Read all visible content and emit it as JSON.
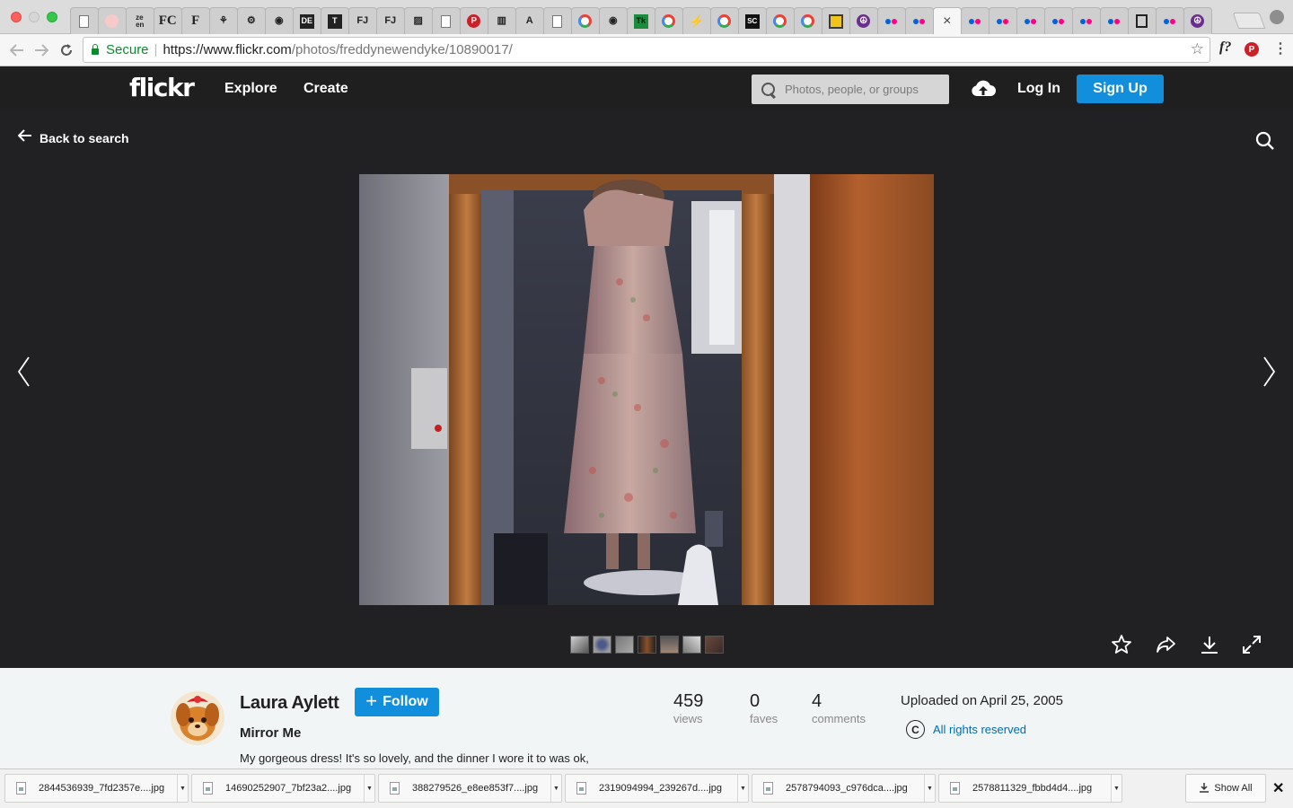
{
  "browser": {
    "tabs": [
      {
        "icon": "page-icon",
        "glyph": ""
      },
      {
        "icon": "pink-circle-icon",
        "glyph": ""
      },
      {
        "icon": "zhen-icon",
        "glyph": "ze\nen"
      },
      {
        "icon": "fc-icon",
        "glyph": "FC"
      },
      {
        "icon": "f-serif-icon",
        "glyph": "F"
      },
      {
        "icon": "figure-icon",
        "glyph": "⚘"
      },
      {
        "icon": "gear-icon",
        "glyph": "⚙"
      },
      {
        "icon": "badge-icon",
        "glyph": "◉"
      },
      {
        "icon": "dark-square-icon",
        "glyph": "DE"
      },
      {
        "icon": "t-icon",
        "glyph": "T"
      },
      {
        "icon": "fj-icon",
        "glyph": "FJ"
      },
      {
        "icon": "fj-icon",
        "glyph": "FJ"
      },
      {
        "icon": "image-icon",
        "glyph": "▨"
      },
      {
        "icon": "page-icon",
        "glyph": ""
      },
      {
        "icon": "pinterest-icon",
        "glyph": "P"
      },
      {
        "icon": "bookmark-icon",
        "glyph": "▥"
      },
      {
        "icon": "a-icon",
        "glyph": "A"
      },
      {
        "icon": "page-icon",
        "glyph": ""
      },
      {
        "icon": "google-icon",
        "glyph": ""
      },
      {
        "icon": "eye-icon",
        "glyph": "◉"
      },
      {
        "icon": "tk-icon",
        "glyph": "Tk"
      },
      {
        "icon": "google-icon",
        "glyph": ""
      },
      {
        "icon": "bolt-icon",
        "glyph": "⚡"
      },
      {
        "icon": "google-icon",
        "glyph": ""
      },
      {
        "icon": "sc-icon",
        "glyph": "SC"
      },
      {
        "icon": "google-icon",
        "glyph": ""
      },
      {
        "icon": "google-icon",
        "glyph": ""
      },
      {
        "icon": "shop-icon",
        "glyph": ""
      },
      {
        "icon": "peace-icon",
        "glyph": "☮"
      },
      {
        "icon": "flickr-icon",
        "glyph": ""
      },
      {
        "icon": "flickr-icon",
        "glyph": ""
      },
      {
        "icon": "close-icon",
        "glyph": "×",
        "active": true
      },
      {
        "icon": "flickr-icon",
        "glyph": ""
      },
      {
        "icon": "flickr-icon",
        "glyph": ""
      },
      {
        "icon": "flickr-icon",
        "glyph": ""
      },
      {
        "icon": "flickr-icon",
        "glyph": ""
      },
      {
        "icon": "flickr-icon",
        "glyph": ""
      },
      {
        "icon": "flickr-icon",
        "glyph": ""
      },
      {
        "icon": "trash-icon",
        "glyph": ""
      },
      {
        "icon": "flickr-icon",
        "glyph": ""
      },
      {
        "icon": "peace-icon",
        "glyph": "☮"
      }
    ],
    "secure_label": "Secure",
    "url_host": "https://www.flickr.com",
    "url_path": "/photos/freddynewendyke/10890017/",
    "colors": {
      "secure": "#0a8a2a",
      "tab_strip": "#dcdcdc"
    }
  },
  "header": {
    "logo": "flickr",
    "nav": [
      "Explore",
      "Create"
    ],
    "search_placeholder": "Photos, people, or groups",
    "login": "Log In",
    "signup": "Sign Up",
    "colors": {
      "bar": "#1f1f1f",
      "accent": "#128fdc"
    }
  },
  "viewer": {
    "back_label": "Back to search",
    "thumbnail_count": 7,
    "actions": [
      "star-icon",
      "share-icon",
      "download-icon",
      "expand-icon"
    ]
  },
  "photo_info": {
    "owner": "Laura Aylett",
    "follow_label": "Follow",
    "title": "Mirror Me",
    "description": "My gorgeous dress! It's so lovely, and the dinner I wore it to was ok,",
    "stats": [
      {
        "value": "459",
        "label": "views"
      },
      {
        "value": "0",
        "label": "faves"
      },
      {
        "value": "4",
        "label": "comments"
      }
    ],
    "uploaded": "Uploaded on April 25, 2005",
    "rights": "All rights reserved",
    "rights_symbol": "C",
    "colors": {
      "link": "#006dac"
    }
  },
  "downloads": {
    "items": [
      "2844536939_7fd2357e....jpg",
      "14690252907_7bf23a2....jpg",
      "388279526_e8ee853f7....jpg",
      "2319094994_239267d....jpg",
      "2578794093_c976dca....jpg",
      "2578811329_fbbd4d4....jpg"
    ],
    "show_all": "Show All"
  }
}
